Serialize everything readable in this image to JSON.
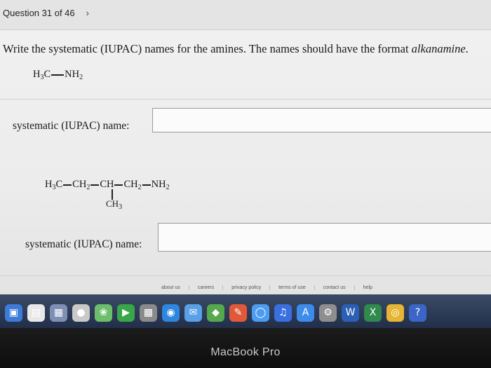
{
  "navigation": {
    "question_counter": "Question 31 of 46",
    "next_chevron": "›"
  },
  "question": {
    "prompt_lead": "Write the systematic (IUPAC) names for the amines. The names should have the format ",
    "prompt_format": "alkanamine",
    "prompt_end": "."
  },
  "item1": {
    "formula": {
      "a": "H",
      "a_sub": "3",
      "b": "C",
      "c": "NH",
      "c_sub": "2"
    },
    "label": "systematic (IUPAC) name:",
    "answer_value": ""
  },
  "item2": {
    "formula": {
      "p1": "H",
      "p1_sub": "3",
      "p2": "C",
      "p3": "CH",
      "p3_sub": "2",
      "p4": "CH",
      "p5": "CH",
      "p5_sub": "2",
      "p6": "NH",
      "p6_sub": "2",
      "branch": "CH",
      "branch_sub": "3"
    },
    "label": "systematic (IUPAC) name:",
    "answer_value": ""
  },
  "footer": {
    "links": [
      "about us",
      "careers",
      "privacy policy",
      "terms of use",
      "contact us",
      "help"
    ]
  },
  "dock": {
    "icons": [
      {
        "name": "finder-icon",
        "glyph": "▣",
        "color": "#3d7bd9"
      },
      {
        "name": "notes-icon",
        "glyph": "▤",
        "color": "#e8e8e8"
      },
      {
        "name": "calendar-icon",
        "glyph": "▦",
        "color": "#7d8fb5"
      },
      {
        "name": "launchpad-icon",
        "glyph": "●",
        "color": "#c9c9c9"
      },
      {
        "name": "photos-icon",
        "glyph": "❀",
        "color": "#6bbf6b"
      },
      {
        "name": "facetime-icon",
        "glyph": "▶",
        "color": "#3aa64a"
      },
      {
        "name": "grid-icon",
        "glyph": "▩",
        "color": "#8a8a8a"
      },
      {
        "name": "safari-icon",
        "glyph": "◉",
        "color": "#2f86e0"
      },
      {
        "name": "mail-icon",
        "glyph": "✉",
        "color": "#5aa0e6"
      },
      {
        "name": "maps-icon",
        "glyph": "◆",
        "color": "#55a84d"
      },
      {
        "name": "pin-icon",
        "glyph": "✎",
        "color": "#e05a3a"
      },
      {
        "name": "messages-icon",
        "glyph": "◯",
        "color": "#4c9cf0"
      },
      {
        "name": "music-icon",
        "glyph": "♫",
        "color": "#3a6fe0"
      },
      {
        "name": "appstore-icon",
        "glyph": "A",
        "color": "#3d8bea"
      },
      {
        "name": "settings-icon",
        "glyph": "⚙",
        "color": "#8e8e8e"
      },
      {
        "name": "word-icon",
        "glyph": "W",
        "color": "#2b5fb5"
      },
      {
        "name": "excel-icon",
        "glyph": "X",
        "color": "#2f8a4c"
      },
      {
        "name": "chrome-icon",
        "glyph": "◎",
        "color": "#e5b533"
      },
      {
        "name": "help-icon",
        "glyph": "?",
        "color": "#3b66c7"
      }
    ]
  },
  "laptop": {
    "brand_label": "MacBook Pro"
  }
}
